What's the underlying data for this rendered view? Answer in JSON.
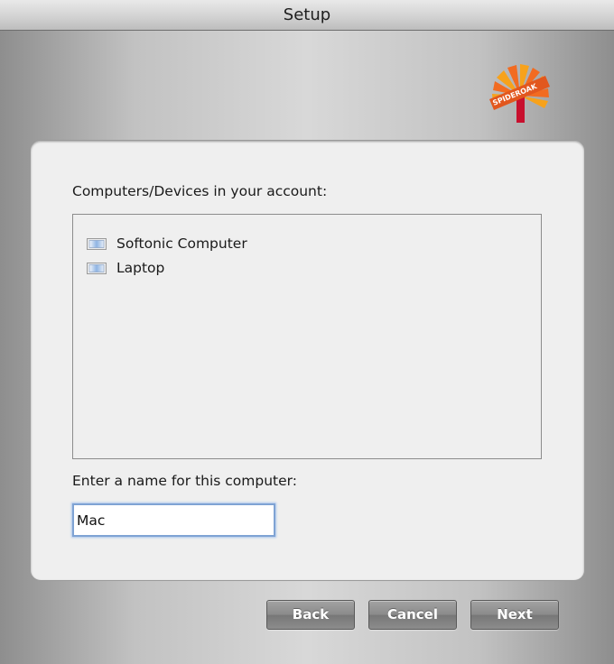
{
  "window": {
    "title": "Setup"
  },
  "logo": {
    "text": "SPIDEROAK",
    "colors": [
      "#f7a21b",
      "#f26b21",
      "#c8102e"
    ]
  },
  "devices": {
    "label": "Computers/Devices in your account:",
    "items": [
      {
        "label": "Softonic Computer",
        "icon": "computer-icon"
      },
      {
        "label": "Laptop",
        "icon": "computer-icon"
      }
    ]
  },
  "computer_name": {
    "label": "Enter a name for this computer:",
    "value": "Mac"
  },
  "buttons": {
    "back": "Back",
    "cancel": "Cancel",
    "next": "Next"
  }
}
